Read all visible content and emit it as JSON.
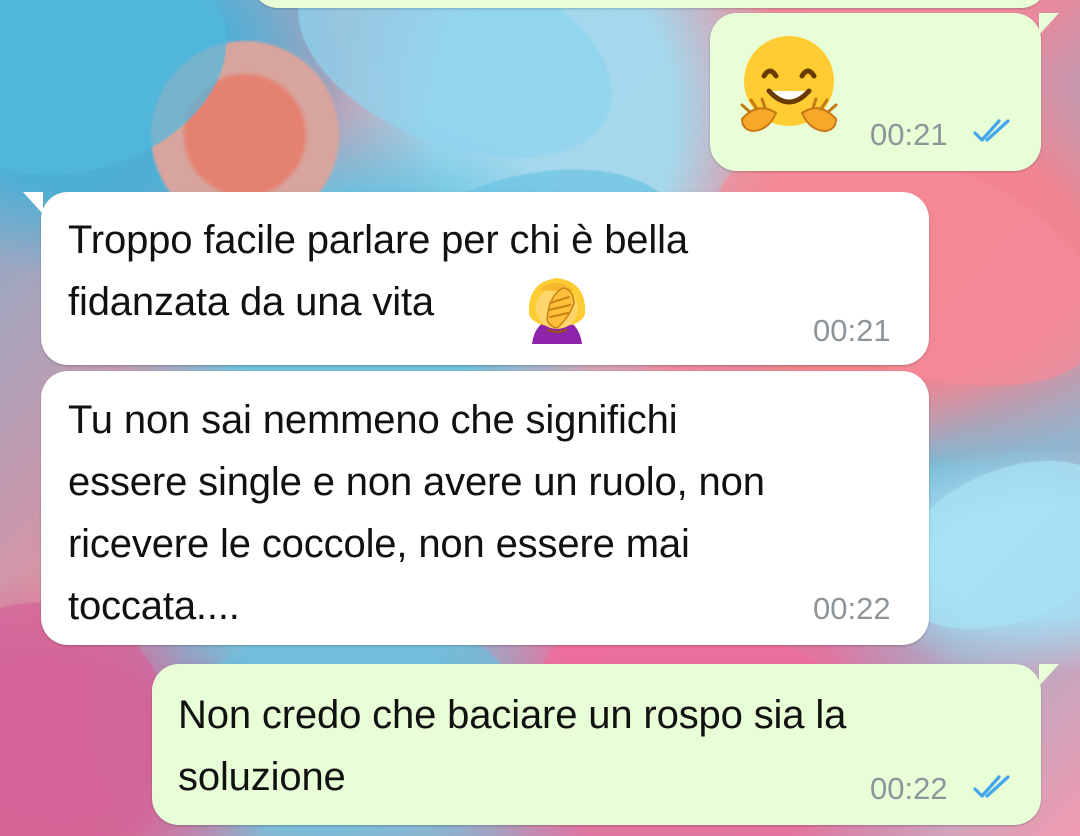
{
  "chat": {
    "messages": [
      {
        "direction": "outgoing",
        "content": "🤗",
        "time": "00:21",
        "status": "read"
      },
      {
        "direction": "incoming",
        "text": "Troppo facile parlare per chi è bella\nfidanzata da una vita",
        "emoji": "🤦‍♀️",
        "time": "00:21"
      },
      {
        "direction": "incoming",
        "text": "Tu non sai nemmeno che significhi\nessere single e non avere un ruolo, non\nricevere le coccole, non essere mai\ntoccata....",
        "time": "00:22"
      },
      {
        "direction": "outgoing",
        "text": "Non credo che baciare un rospo sia la\nsoluzione",
        "time": "00:22",
        "status": "read"
      }
    ]
  },
  "icons": {
    "read_receipt": "double-check-icon",
    "hug_emoji": "hugging-face-emoji",
    "facepalm_emoji": "woman-facepalming-emoji"
  },
  "colors": {
    "incoming_bubble": "#ffffff",
    "outgoing_bubble": "#e8fed7",
    "timestamp": "#8e959a",
    "read_tick": "#43a7ed"
  }
}
